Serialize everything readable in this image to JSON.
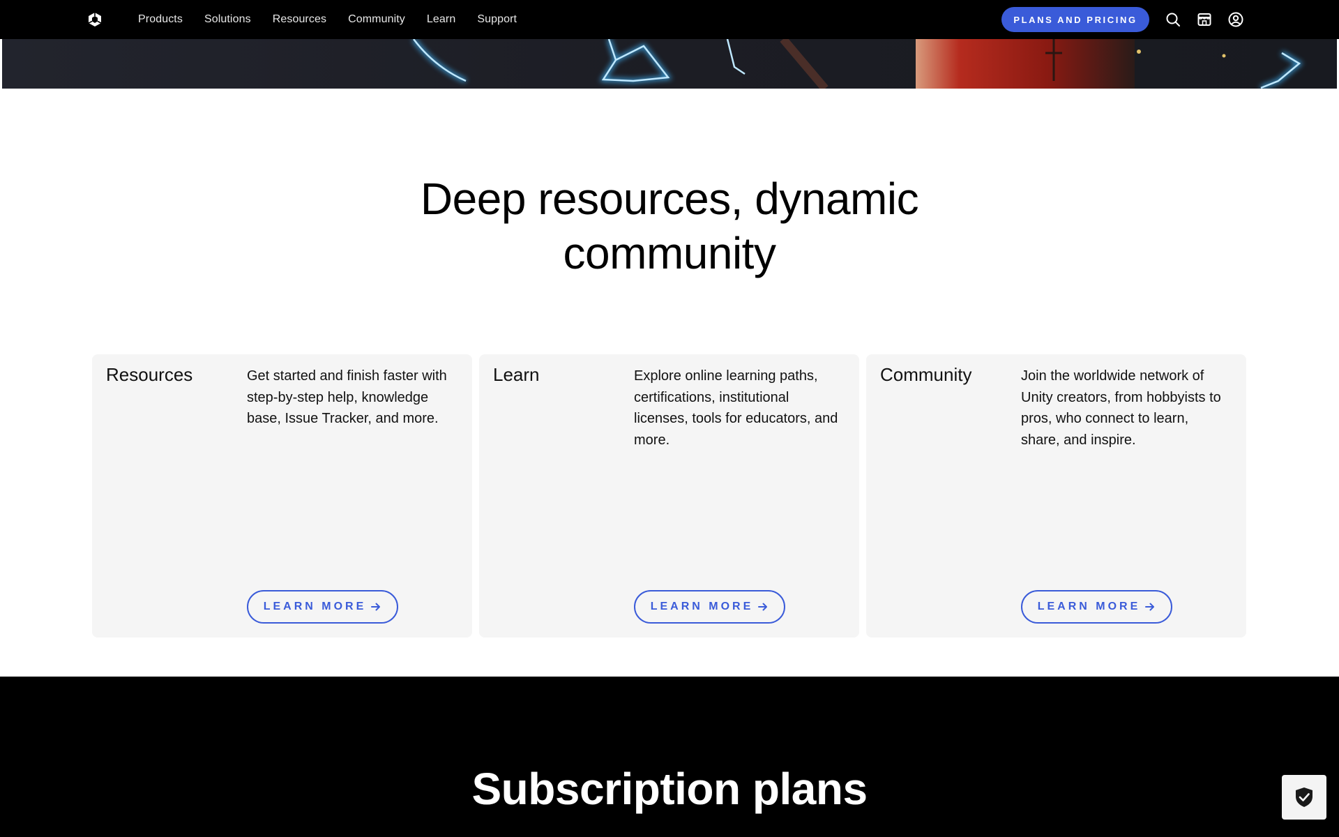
{
  "nav": {
    "links": [
      "Products",
      "Solutions",
      "Resources",
      "Community",
      "Learn",
      "Support"
    ],
    "plans_label": "PLANS AND PRICING",
    "icons": [
      "search-icon",
      "store-icon",
      "account-icon"
    ]
  },
  "section": {
    "title_line1": "Deep resources, dynamic",
    "title_line2": "community"
  },
  "cards": [
    {
      "title": "Resources",
      "description": "Get started and finish faster with step-by-step help, knowledge base, Issue Tracker, and more.",
      "button": "LEARN MORE"
    },
    {
      "title": "Learn",
      "description": "Explore online learning paths, certifications, institutional licenses, tools for educators, and more.",
      "button": "LEARN MORE"
    },
    {
      "title": "Community",
      "description": "Join the worldwide network of Unity creators, from hobbyists to pros, who connect to learn, share, and inspire.",
      "button": "LEARN MORE"
    }
  ],
  "subscription": {
    "title": "Subscription plans"
  },
  "colors": {
    "accent": "#3a5bd9",
    "nav_bg": "#000000",
    "card_bg": "#f5f5f5"
  }
}
